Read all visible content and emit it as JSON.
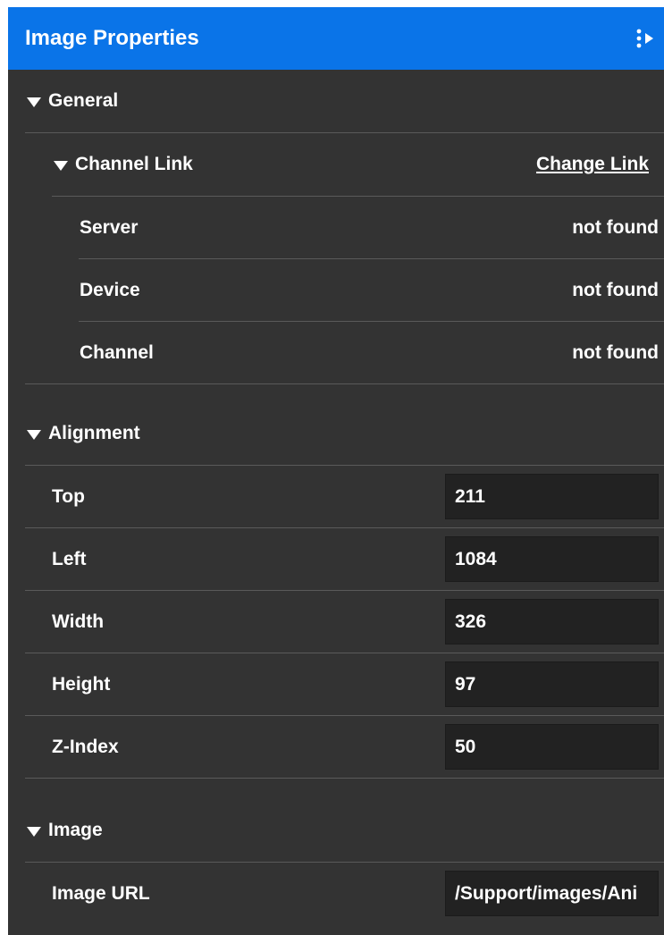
{
  "panel": {
    "title": "Image Properties",
    "collapse_icon": "panel-collapse-icon"
  },
  "colors": {
    "header_bg": "#0a74e8",
    "panel_bg": "#333333",
    "input_bg": "#222222",
    "divider": "#5a5a5a",
    "text": "#ffffff"
  },
  "general": {
    "label": "General",
    "channel_link": {
      "label": "Channel Link",
      "change_link_label": "Change Link",
      "rows": [
        {
          "label": "Server",
          "value": "not found"
        },
        {
          "label": "Device",
          "value": "not found"
        },
        {
          "label": "Channel",
          "value": "not found"
        }
      ]
    }
  },
  "alignment": {
    "label": "Alignment",
    "fields": [
      {
        "label": "Top",
        "value": "211"
      },
      {
        "label": "Left",
        "value": "1084"
      },
      {
        "label": "Width",
        "value": "326"
      },
      {
        "label": "Height",
        "value": "97"
      },
      {
        "label": "Z-Index",
        "value": "50"
      }
    ]
  },
  "image": {
    "label": "Image",
    "url_label": "Image URL",
    "url_value": "/Support/images/Ani"
  }
}
